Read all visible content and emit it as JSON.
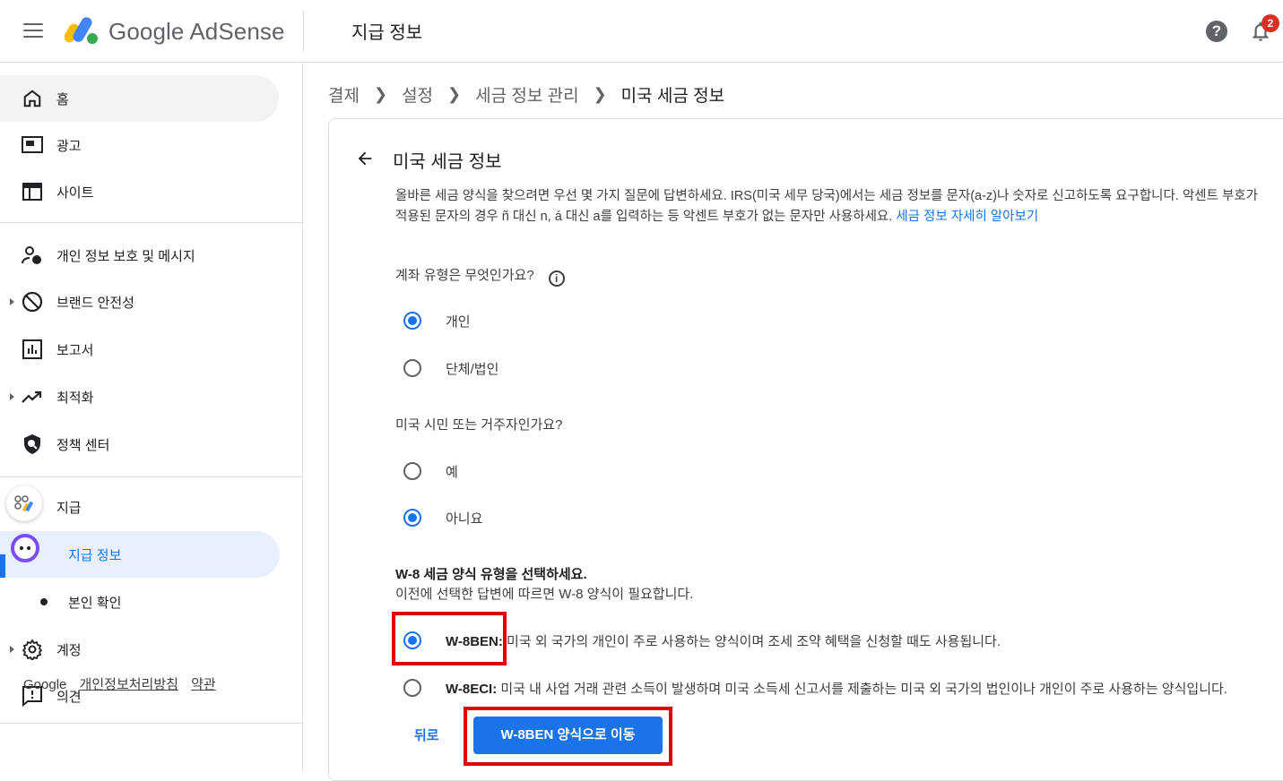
{
  "app": {
    "brand": "Google AdSense",
    "page_title": "지급 정보",
    "help_symbol": "?",
    "notification_count": "2"
  },
  "sidebar": {
    "items": [
      {
        "label": "홈",
        "icon": "home-icon"
      },
      {
        "label": "광고",
        "icon": "ads-icon"
      },
      {
        "label": "사이트",
        "icon": "sites-icon"
      },
      {
        "label": "개인 정보 보호 및 메시지",
        "icon": "privacy-icon"
      },
      {
        "label": "브랜드 안전성",
        "icon": "block-icon"
      },
      {
        "label": "보고서",
        "icon": "reports-icon"
      },
      {
        "label": "최적화",
        "icon": "trending-icon"
      },
      {
        "label": "정책 센터",
        "icon": "policy-shield-icon"
      },
      {
        "label": "지급",
        "icon": "payments-icon"
      },
      {
        "label": "지급 정보",
        "icon": "payments-info-icon"
      },
      {
        "label": "본인 확인",
        "icon": "bullet-icon"
      },
      {
        "label": "계정",
        "icon": "gear-icon"
      },
      {
        "label": "의견",
        "icon": "feedback-icon"
      }
    ],
    "footer": {
      "google": "Google",
      "privacy": "개인정보처리방침",
      "terms": "약관"
    }
  },
  "breadcrumb": [
    "결제",
    "설정",
    "세금 정보 관리",
    "미국 세금 정보"
  ],
  "card": {
    "title": "미국 세금 정보",
    "intro": "올바른 세금 양식을 찾으려면 우선 몇 가지 질문에 답변하세요. IRS(미국 세무 당국)에서는 세금 정보를 문자(a-z)나 숫자로 신고하도록 요구합니다. 악센트 부호가 적용된 문자의 경우 ñ 대신 n, á 대신 a를 입력하는 등 악센트 부호가 없는 문자만 사용하세요.",
    "intro_link": "세금 정보 자세히 알아보기",
    "q1": "계좌 유형은 무엇인가요?",
    "q1_options": [
      {
        "label": "개인",
        "checked": true
      },
      {
        "label": "단체/법인",
        "checked": false
      }
    ],
    "q2": "미국 시민 또는 거주자인가요?",
    "q2_options": [
      {
        "label": "예",
        "checked": false
      },
      {
        "label": "아니요",
        "checked": true
      }
    ],
    "section_title": "W-8 세금 양식 유형을 선택하세요.",
    "section_sub": "이전에 선택한 답변에 따르면 W-8 양식이 필요합니다.",
    "forms": [
      {
        "name": "W-8BEN:",
        "desc": "미국 외 국가의 개인이 주로 사용하는 양식이며 조세 조약 혜택을 신청할 때도 사용됩니다.",
        "checked": true
      },
      {
        "name": "W-8ECI:",
        "desc": "미국 내 사업 거래 관련 소득이 발생하며 미국 소득세 신고서를 제출하는 미국 외 국가의 법인이나 개인이 주로 사용하는 양식입니다.",
        "checked": false
      }
    ],
    "back_label": "뒤로",
    "primary_label": "W-8BEN 양식으로 이동"
  },
  "colors": {
    "accent": "#1a73e8",
    "highlight": "#e00000",
    "badge": "#d93025"
  }
}
